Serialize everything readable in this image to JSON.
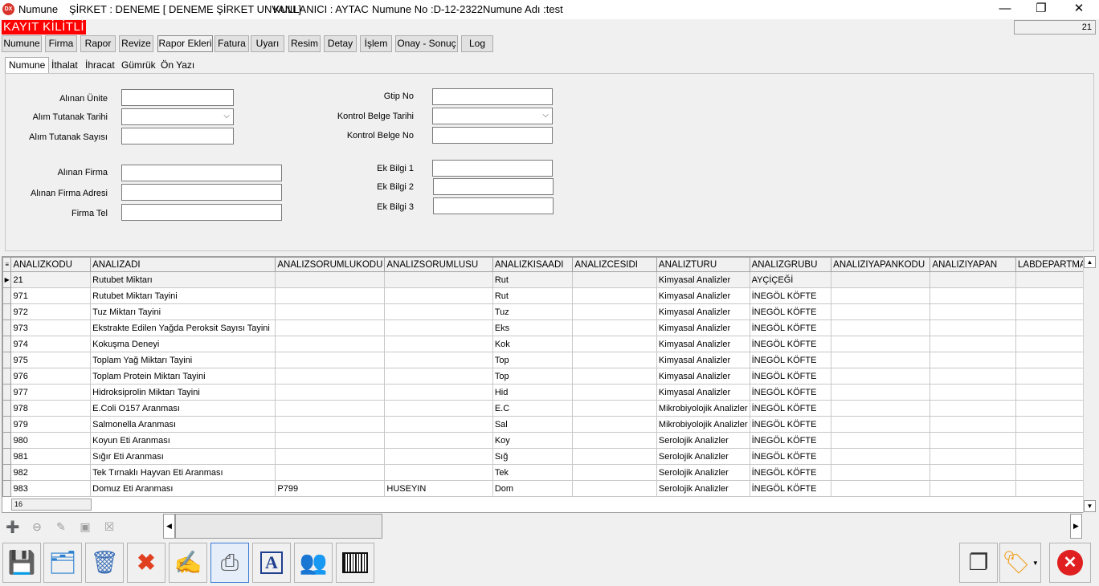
{
  "window": {
    "app_name": "Numune",
    "company": "ŞİRKET : DENEME [ DENEME ŞİRKET UNVANI ]",
    "user": "KULLANICI : AYTAC",
    "sample_no": "Numune No :D-12-2322",
    "sample_name": "Numune Adı :test",
    "app_icon_text": "DX",
    "minimize": "—",
    "restore": "❐",
    "close": "✕"
  },
  "status": {
    "lock_banner": "KAYIT KİLİTLİ",
    "counter": "21"
  },
  "menu": [
    "Numune",
    "Firma",
    "Rapor",
    "Revize",
    "Rapor Ekleri",
    "Fatura",
    "Uyarı",
    "Resim",
    "Detay",
    "İşlem",
    "Onay - Sonuç",
    "Log"
  ],
  "subtabs": [
    "Numune",
    "İthalat",
    "İhracat",
    "Gümrük",
    "Ön Yazı"
  ],
  "form": {
    "alinan_unite": "Alınan Ünite",
    "alim_tutanak_tarihi": "Alım Tutanak Tarihi",
    "alim_tutanak_sayisi": "Alım Tutanak Sayısı",
    "alinan_firma": "Alınan Firma",
    "alinan_firma_adresi": "Alınan Firma Adresi",
    "firma_tel": "Firma Tel",
    "gtip_no": "Gtip No",
    "kontrol_belge_tarihi": "Kontrol Belge Tarihi",
    "kontrol_belge_no": "Kontrol Belge No",
    "ek_bilgi_1": "Ek Bilgi 1",
    "ek_bilgi_2": "Ek Bilgi 2",
    "ek_bilgi_3": "Ek Bilgi 3"
  },
  "grid": {
    "columns": [
      "ANALIZKODU",
      "ANALIZADI",
      "ANALIZSORUMLUKODU",
      "ANALIZSORUMLUSU",
      "ANALIZKISAADI",
      "ANALIZCESIDI",
      "ANALIZTURU",
      "ANALIZGRUBU",
      "ANALIZIYAPANKODU",
      "ANALIZIYAPAN",
      "LABDEPARTMAN"
    ],
    "rows": [
      [
        "21",
        "Rutubet Miktarı",
        "",
        "",
        "Rut",
        "",
        "Kimyasal Analizler",
        "AYÇİÇEĞİ",
        "",
        "",
        ""
      ],
      [
        "971",
        "Rutubet Miktarı Tayini",
        "",
        "",
        "Rut",
        "",
        "Kimyasal Analizler",
        "İNEGÖL KÖFTE",
        "",
        "",
        ""
      ],
      [
        "972",
        "Tuz Miktarı Tayini",
        "",
        "",
        "Tuz",
        "",
        "Kimyasal Analizler",
        "İNEGÖL KÖFTE",
        "",
        "",
        ""
      ],
      [
        "973",
        "Ekstrakte Edilen Yağda Peroksit Sayısı Tayini",
        "",
        "",
        "Eks",
        "",
        "Kimyasal Analizler",
        "İNEGÖL KÖFTE",
        "",
        "",
        ""
      ],
      [
        "974",
        "Kokuşma Deneyi",
        "",
        "",
        "Kok",
        "",
        "Kimyasal Analizler",
        "İNEGÖL KÖFTE",
        "",
        "",
        ""
      ],
      [
        "975",
        "Toplam Yağ Miktarı Tayini",
        "",
        "",
        "Top",
        "",
        "Kimyasal Analizler",
        "İNEGÖL KÖFTE",
        "",
        "",
        ""
      ],
      [
        "976",
        "Toplam Protein Miktarı Tayini",
        "",
        "",
        "Top",
        "",
        "Kimyasal Analizler",
        "İNEGÖL KÖFTE",
        "",
        "",
        ""
      ],
      [
        "977",
        "Hidroksiprolin Miktarı Tayini",
        "",
        "",
        "Hid",
        "",
        "Kimyasal Analizler",
        "İNEGÖL KÖFTE",
        "",
        "",
        ""
      ],
      [
        "978",
        "E.Coli O157 Aranması",
        "",
        "",
        "E.C",
        "",
        "Mikrobiyolojik Analizler",
        "İNEGÖL KÖFTE",
        "",
        "",
        ""
      ],
      [
        "979",
        "Salmonella Aranması",
        "",
        "",
        "Sal",
        "",
        "Mikrobiyolojik Analizler",
        "İNEGÖL KÖFTE",
        "",
        "",
        ""
      ],
      [
        "980",
        "Koyun Eti Aranması",
        "",
        "",
        "Koy",
        "",
        "Serolojik Analizler",
        "İNEGÖL KÖFTE",
        "",
        "",
        ""
      ],
      [
        "981",
        "Sığır Eti Aranması",
        "",
        "",
        "Sığ",
        "",
        "Serolojik Analizler",
        "İNEGÖL KÖFTE",
        "",
        "",
        ""
      ],
      [
        "982",
        "Tek Tırnaklı Hayvan Eti Aranması",
        "",
        "",
        "Tek",
        "",
        "Serolojik Analizler",
        "İNEGÖL KÖFTE",
        "",
        "",
        ""
      ],
      [
        "983",
        "Domuz Eti Aranması",
        "P799",
        "HUSEYIN",
        "Dom",
        "",
        "Serolojik Analizler",
        "İNEGÖL KÖFTE",
        "",
        "",
        ""
      ]
    ],
    "footer_count": "16"
  },
  "toolbar_icons": [
    "save-icon",
    "new-record-icon",
    "delete-icon",
    "cancel-icon",
    "edit-icon",
    "print-icon",
    "font-icon",
    "users-icon",
    "barcode-icon",
    "copy-icon",
    "tag-icon",
    "exit-icon"
  ]
}
